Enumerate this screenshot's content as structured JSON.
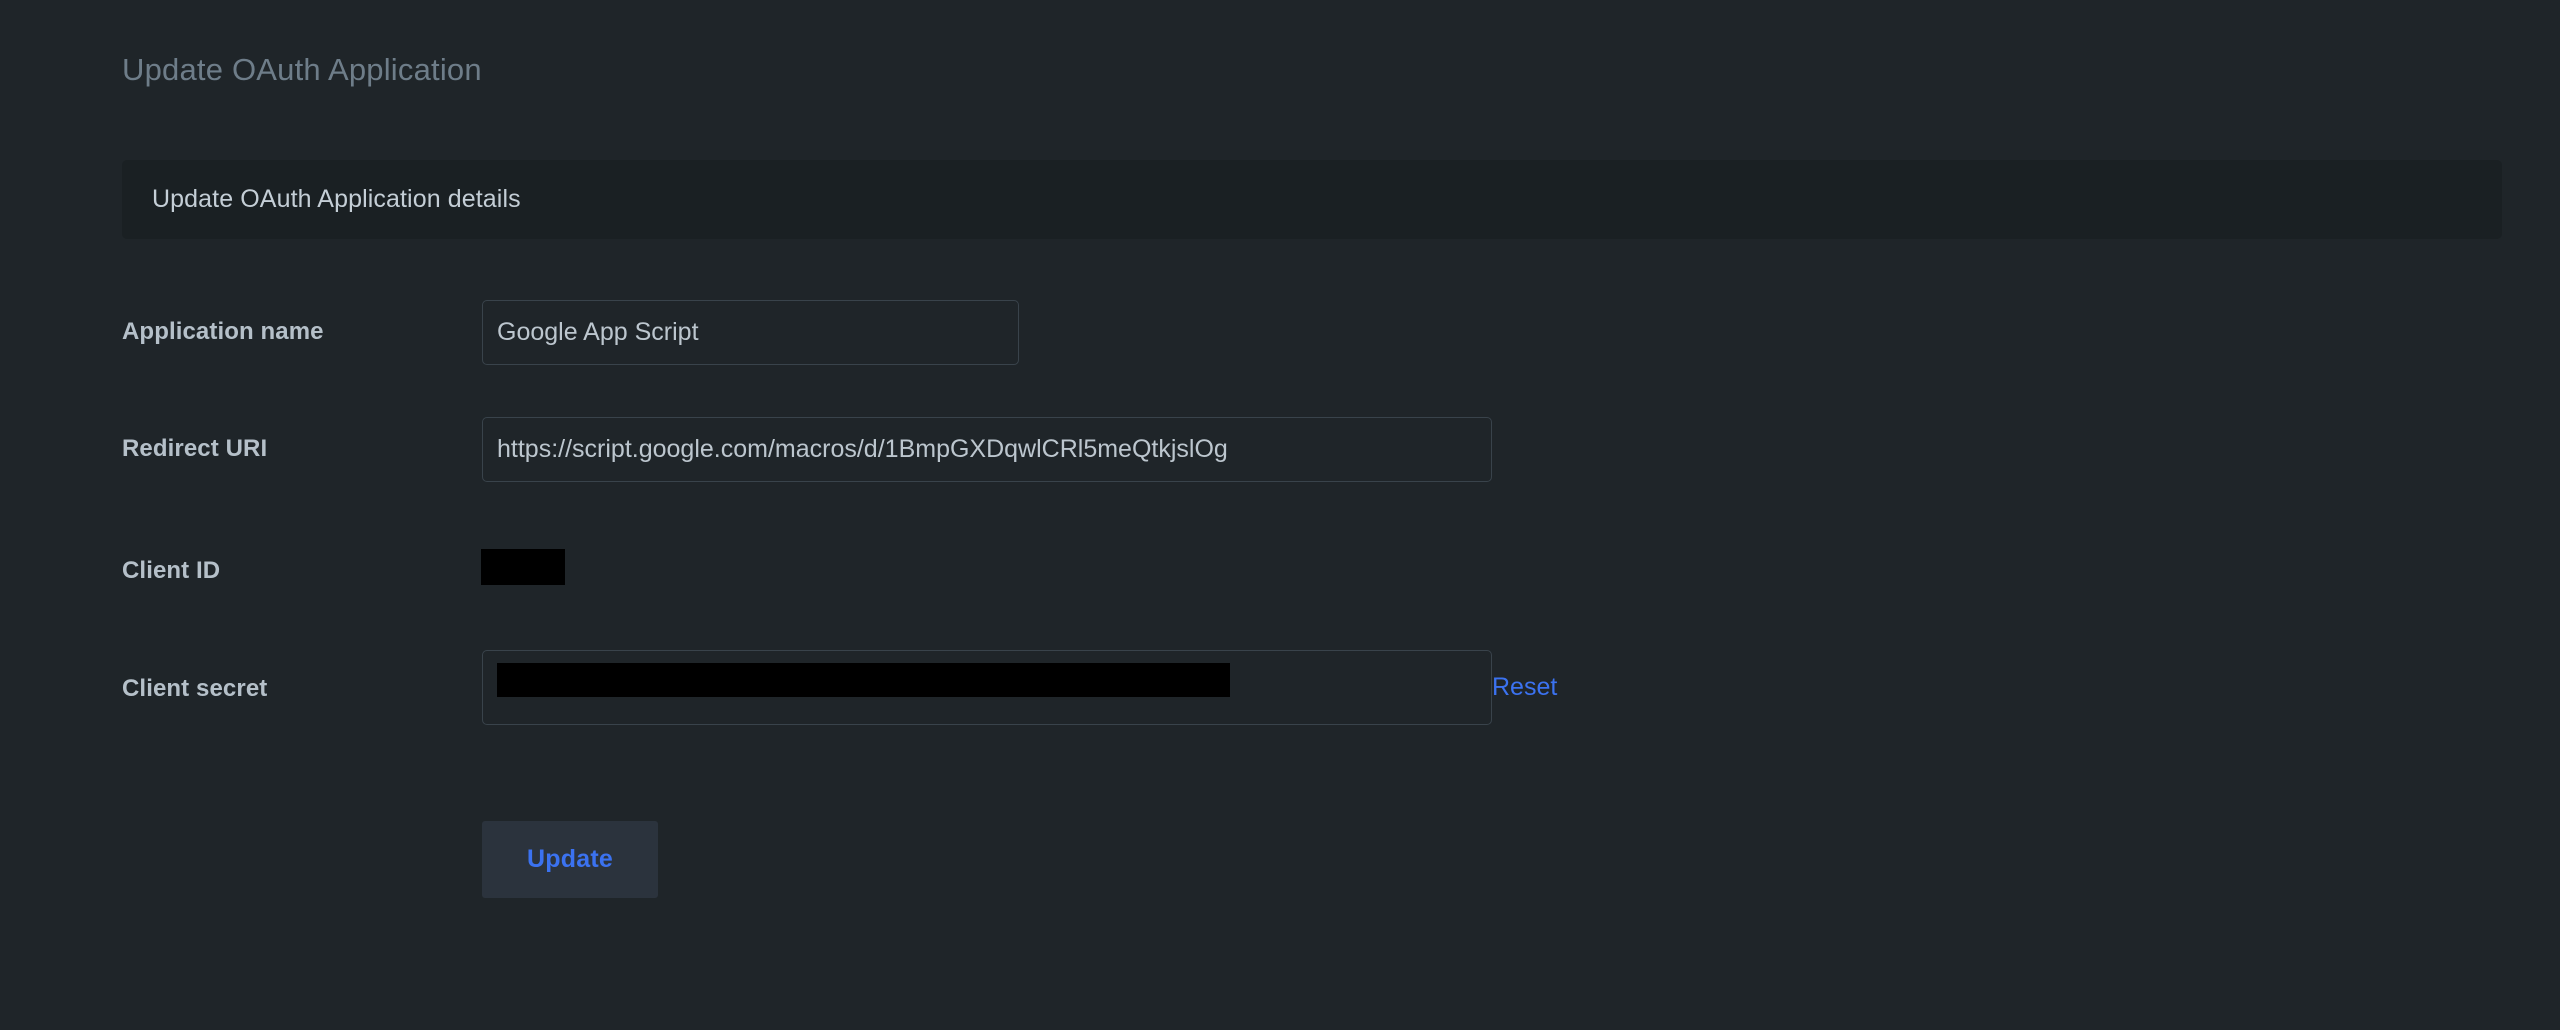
{
  "page": {
    "title": "Update OAuth Application",
    "background_color": "#1f2529"
  },
  "panel": {
    "header_title": "Update OAuth Application details",
    "header_background": "#1a2023"
  },
  "form": {
    "fields": [
      {
        "label": "Application name",
        "value": "Google App Script",
        "placeholder": "Application name",
        "redacted": false
      },
      {
        "label": "Redirect URI",
        "value": "https://script.google.com/macros/d/1BmpGXDqwlCRl5meQtkjslOg",
        "placeholder": "Redirect URI",
        "redacted": false
      },
      {
        "label": "Client ID",
        "value": "",
        "placeholder": "",
        "redacted": true
      },
      {
        "label": "Client secret",
        "value": "",
        "placeholder": "",
        "redacted": true
      }
    ],
    "reset_label": "Reset",
    "submit_label": "Update"
  },
  "colors": {
    "accent_link": "#3b72f0",
    "label_text": "#b5c0c9",
    "title_text": "#6e7d89",
    "header_text": "#c4ced6",
    "input_border": "#39434b",
    "redaction": "#000000",
    "button_background": "#2b333d"
  }
}
